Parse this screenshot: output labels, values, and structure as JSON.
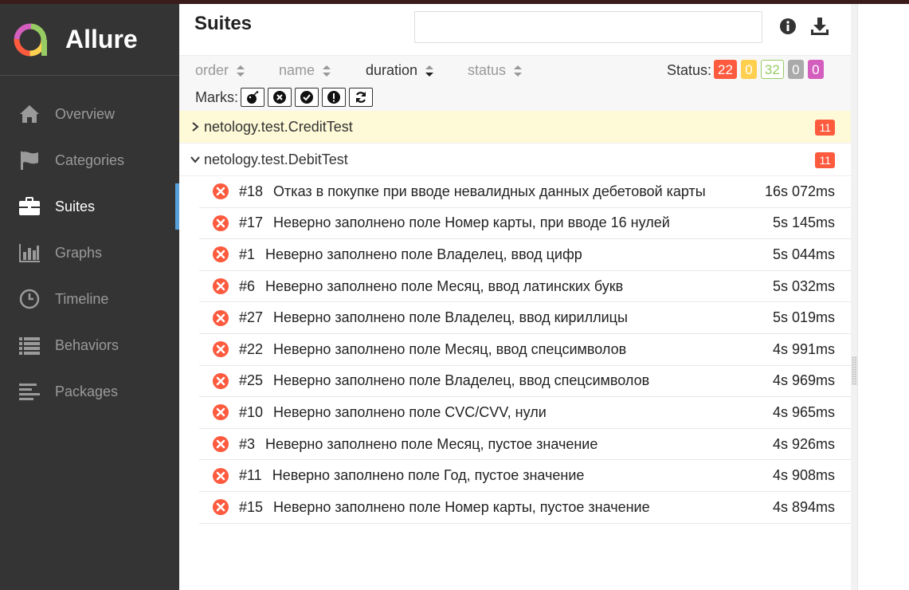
{
  "app": {
    "name": "Allure"
  },
  "colors": {
    "sidebar": "#343434",
    "accent": "#5aa0d8",
    "failed": "#fd5a3e",
    "broken": "#ffd050",
    "passed": "#97cc64",
    "skipped": "#aaaaaa",
    "unknown": "#d35ebe",
    "highlight": "#fef9d7"
  },
  "nav": [
    {
      "label": "Overview",
      "icon": "home-icon"
    },
    {
      "label": "Categories",
      "icon": "flag-icon"
    },
    {
      "label": "Suites",
      "icon": "briefcase-icon",
      "active": true
    },
    {
      "label": "Graphs",
      "icon": "bar-chart-icon"
    },
    {
      "label": "Timeline",
      "icon": "clock-icon"
    },
    {
      "label": "Behaviors",
      "icon": "list-icon"
    },
    {
      "label": "Packages",
      "icon": "align-left-icon"
    }
  ],
  "header": {
    "title": "Suites",
    "search_value": "",
    "search_placeholder": ""
  },
  "sorters": {
    "order": "order",
    "name": "name",
    "duration": "duration",
    "status": "status"
  },
  "status_filter": {
    "label": "Status:",
    "badges": {
      "failed": "22",
      "broken": "0",
      "passed": "32",
      "skipped": "0",
      "unknown": "0"
    }
  },
  "marks": {
    "label": "Marks:"
  },
  "suites": [
    {
      "name": "netology.test.CreditTest",
      "count": "11",
      "expanded": false
    },
    {
      "name": "netology.test.DebitTest",
      "count": "11",
      "expanded": true
    }
  ],
  "tests": [
    {
      "order": "#18",
      "name": "Отказ в покупке при вводе невалидных данных дебетовой карты",
      "duration": "16s 072ms",
      "status": "failed"
    },
    {
      "order": "#17",
      "name": "Неверно заполнено поле Номер карты, при вводе 16 нулей",
      "duration": "5s 145ms",
      "status": "failed"
    },
    {
      "order": "#1",
      "name": "Неверно заполнено поле Владелец, ввод цифр",
      "duration": "5s 044ms",
      "status": "failed"
    },
    {
      "order": "#6",
      "name": "Неверно заполнено поле Месяц, ввод латинских букв",
      "duration": "5s 032ms",
      "status": "failed"
    },
    {
      "order": "#27",
      "name": "Неверно заполнено поле Владелец, ввод кириллицы",
      "duration": "5s 019ms",
      "status": "failed"
    },
    {
      "order": "#22",
      "name": "Неверно заполнено поле Месяц, ввод спецсимволов",
      "duration": "4s 991ms",
      "status": "failed"
    },
    {
      "order": "#25",
      "name": "Неверно заполнено поле Владелец, ввод спецсимволов",
      "duration": "4s 969ms",
      "status": "failed"
    },
    {
      "order": "#10",
      "name": "Неверно заполнено поле CVC/CVV, нули",
      "duration": "4s 965ms",
      "status": "failed"
    },
    {
      "order": "#3",
      "name": "Неверно заполнено поле Месяц, пустое значение",
      "duration": "4s 926ms",
      "status": "failed"
    },
    {
      "order": "#11",
      "name": "Неверно заполнено поле Год, пустое значение",
      "duration": "4s 908ms",
      "status": "failed"
    },
    {
      "order": "#15",
      "name": "Неверно заполнено поле Номер карты, пустое значение",
      "duration": "4s 894ms",
      "status": "failed"
    }
  ]
}
